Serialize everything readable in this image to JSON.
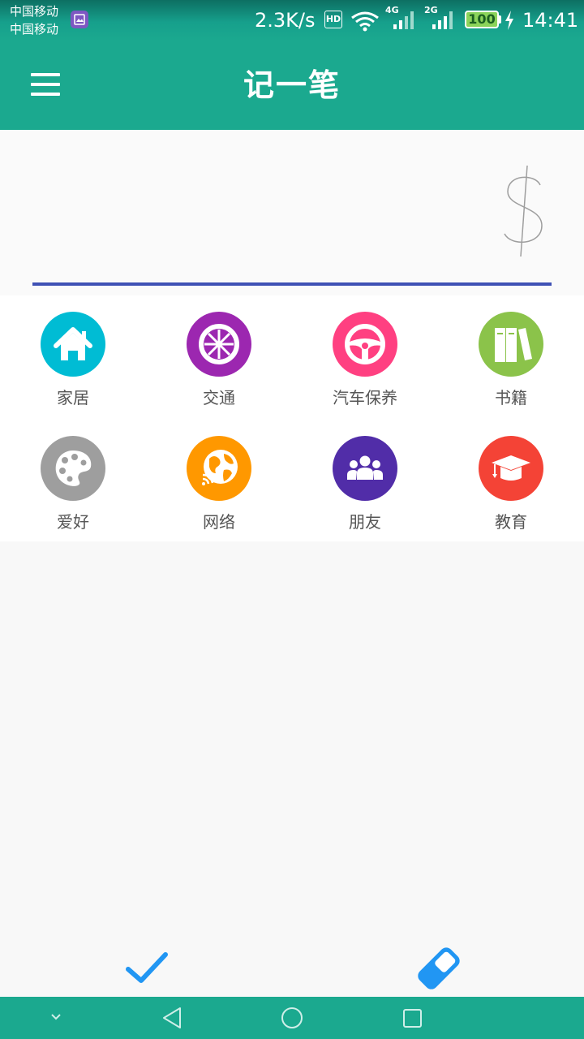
{
  "status_bar": {
    "carrier_1": "中国移动",
    "carrier_2": "中国移动",
    "net_speed": "2.3K/s",
    "hd_label": "HD",
    "net_4g": "4G",
    "net_2g": "2G",
    "battery": "100",
    "time": "14:41"
  },
  "app_bar": {
    "title": "记一笔",
    "menu_icon": "hamburger-menu-icon"
  },
  "amount": {
    "value": "",
    "currency_icon": "dollar-icon",
    "underline_color": "#3f51b5"
  },
  "categories": [
    {
      "label": "家居",
      "icon": "house-icon",
      "color": "#00bcd4"
    },
    {
      "label": "交通",
      "icon": "wheel-icon",
      "color": "#9c27b0"
    },
    {
      "label": "汽车保养",
      "icon": "steering-wheel-icon",
      "color": "#ff4081"
    },
    {
      "label": "书籍",
      "icon": "books-icon",
      "color": "#8bc34a"
    },
    {
      "label": "爱好",
      "icon": "palette-icon",
      "color": "#9e9e9e"
    },
    {
      "label": "网络",
      "icon": "globe-network-icon",
      "color": "#ff9800"
    },
    {
      "label": "朋友",
      "icon": "people-icon",
      "color": "#512da8"
    },
    {
      "label": "教育",
      "icon": "graduation-cap-icon",
      "color": "#f44336"
    }
  ],
  "actions": {
    "confirm_icon": "checkmark-icon",
    "eraser_icon": "eraser-icon",
    "accent_color": "#2196f3"
  },
  "colors": {
    "primary": "#1ba98f"
  }
}
